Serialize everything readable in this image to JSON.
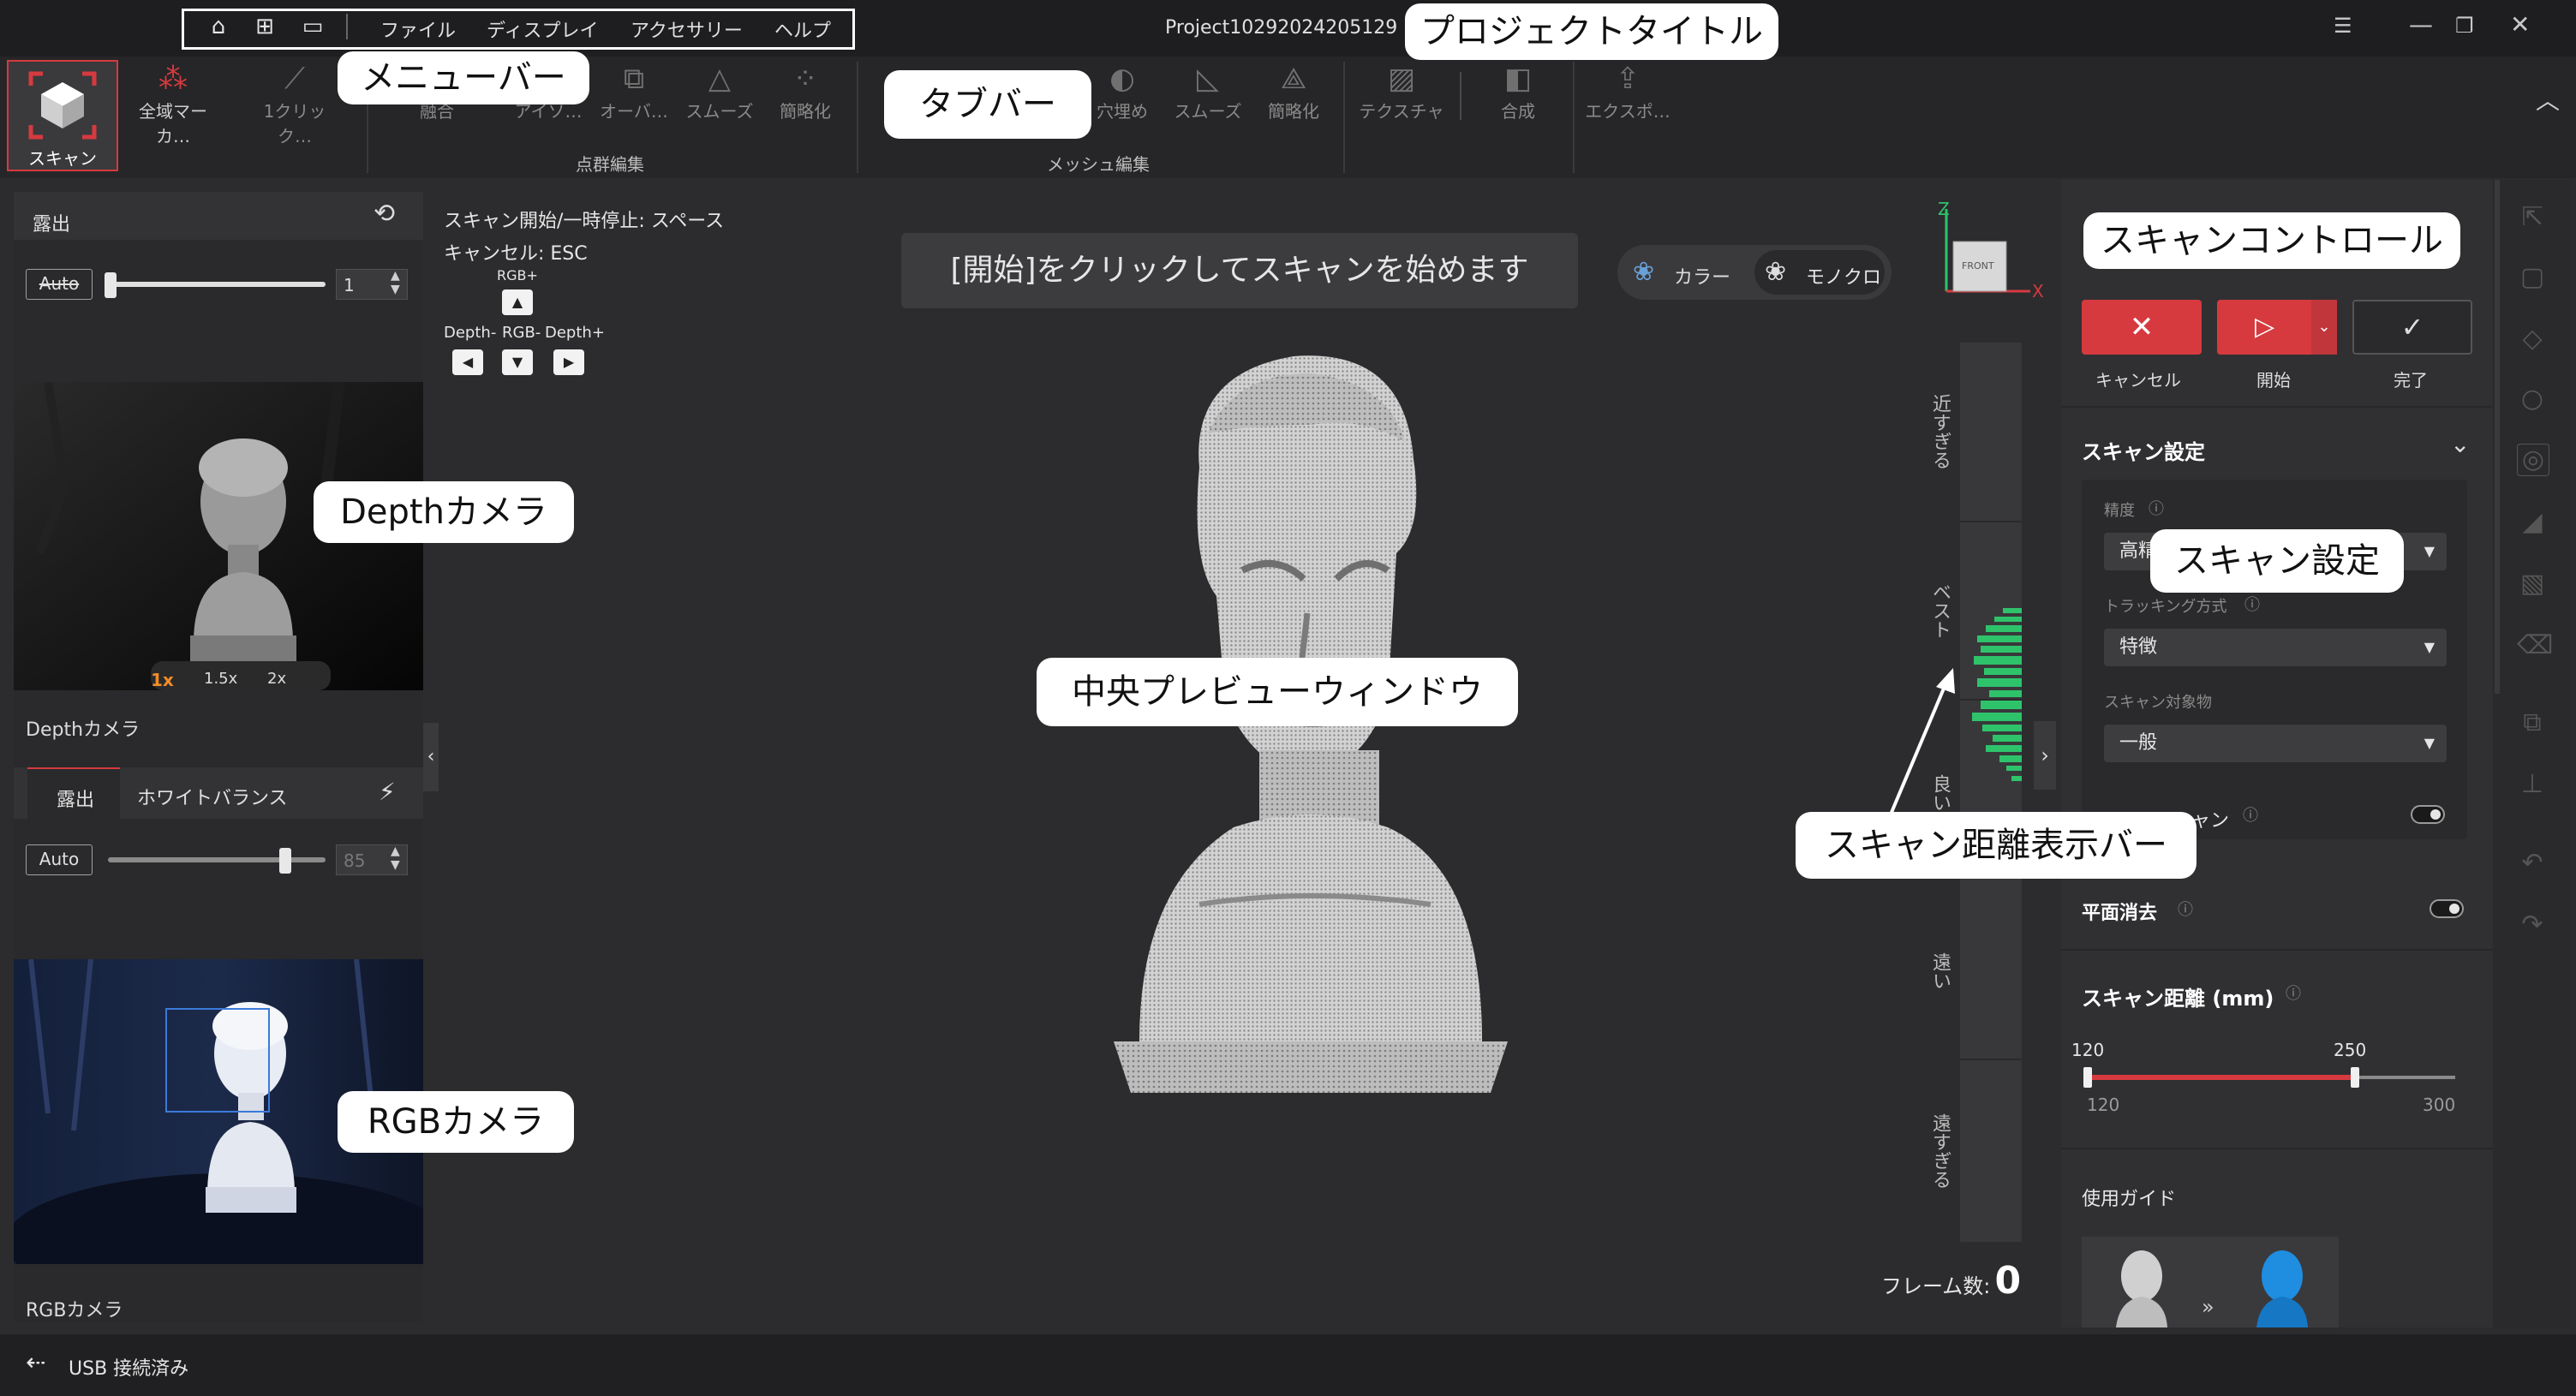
{
  "titlebar": {
    "menu": [
      "ファイル",
      "ディスプレイ",
      "アクセサリー",
      "ヘルプ"
    ],
    "project_title": "Project10292024205129",
    "icons": [
      "home-icon",
      "new-project-icon",
      "open-folder-icon"
    ]
  },
  "toolbar": {
    "scan_label": "スキャン",
    "global_marker_label": "全域マーカ…",
    "one_click_label": "1クリック…",
    "point_tools": [
      "融合",
      "アイソ…",
      "オーバ…",
      "スムーズ",
      "簡略化"
    ],
    "point_group_label": "点群編集",
    "mesh_tools": [
      "穴埋め",
      "スムーズ",
      "簡略化"
    ],
    "mesh_group_label": "メッシュ編集",
    "texture_label": "テクスチャ",
    "merge_label": "合成",
    "export_label": "エクスポ…"
  },
  "left_panel": {
    "exposure_label": "露出",
    "auto_label": "Auto",
    "exposure_value": "1",
    "zoom_options": [
      "1x",
      "1.5x",
      "2x"
    ],
    "depth_caption": "Depthカメラ",
    "tab_exposure": "露出",
    "tab_white_balance": "ホワイトバランス",
    "auto2_label": "Auto",
    "rgb_value": "85",
    "rgb_caption": "RGBカメラ"
  },
  "center": {
    "hint_line1": "スキャン開始/一時停止: スペース",
    "hint_line2": "キャンセル: ESC",
    "rgb_plus": "RGB+",
    "depth_minus": "Depth-",
    "rgb_minus": "RGB-",
    "depth_plus": "Depth+",
    "banner": "[開始]をクリックしてスキャンを始めます",
    "color_label": "カラー",
    "mono_label": "モノクロ",
    "axis_z": "Z",
    "axis_x": "X",
    "front_label": "FRONT",
    "frame_label": "フレーム数:",
    "frame_value": "0"
  },
  "distance_bar": {
    "labels": [
      "近すぎる",
      "ベスト",
      "良い",
      "遠い",
      "遠すぎる"
    ]
  },
  "right_panel": {
    "cancel_label": "キャンセル",
    "start_label": "開始",
    "done_label": "完了",
    "scan_settings_title": "スキャン設定",
    "precision_label": "精度",
    "precision_value": "高精度",
    "tracking_label": "トラッキング方式",
    "tracking_value": "特徴",
    "target_label": "スキャン対象物",
    "target_value": "一般",
    "hidden_toggle_label": "ャン",
    "plane_removal_label": "平面消去",
    "distance_title": "スキャン距離 (mm)",
    "distance_low": "120",
    "distance_high": "250",
    "distance_min": "120",
    "distance_max": "300",
    "guide_title": "使用ガイド"
  },
  "status": {
    "usb_label": "USB 接続済み"
  },
  "callouts": {
    "menubar": "メニューバー",
    "project_title": "プロジェクトタイトル",
    "tabbar": "タブバー",
    "depth_camera": "Depthカメラ",
    "rgb_camera": "RGBカメラ",
    "center_preview": "中央プレビューウィンドウ",
    "scan_control": "スキャンコントロール",
    "scan_settings": "スキャン設定",
    "distance_bar": "スキャン距離表示バー"
  },
  "colors": {
    "accent_red": "#d63a3f",
    "green_bar": "#2ec36b",
    "bg": "#2c2c2e"
  }
}
